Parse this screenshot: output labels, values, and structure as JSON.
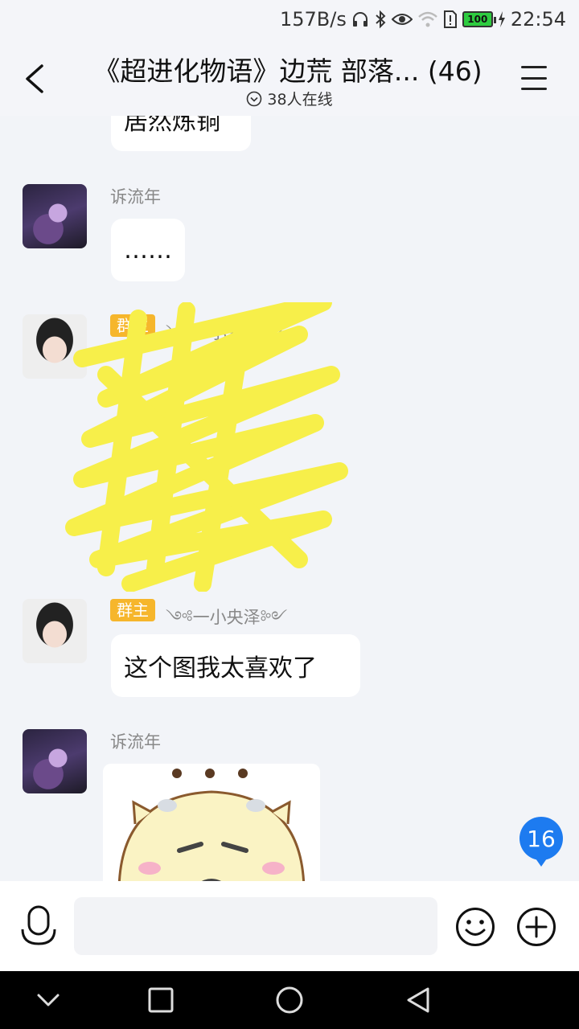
{
  "status_bar": {
    "net_speed": "157B/s",
    "battery": "100",
    "time": "22:54"
  },
  "header": {
    "title": "《超进化物语》边荒  部落... (46)",
    "online": "38人在线"
  },
  "messages": [
    {
      "text": "居然炼铜"
    },
    {
      "sender": "诉流年",
      "text": "……"
    },
    {
      "badge": "群主",
      "sender": "༺一小央泽༻"
    },
    {
      "badge": "群主",
      "sender": "༺一小央泽༻",
      "text": "这个图我太喜欢了"
    },
    {
      "sender": "诉流年"
    }
  ],
  "unread_count": "16",
  "input": {
    "placeholder": ""
  },
  "colors": {
    "accent": "#1d7bf0",
    "badge": "#f6b62c",
    "scribble": "#f7ef4a"
  }
}
